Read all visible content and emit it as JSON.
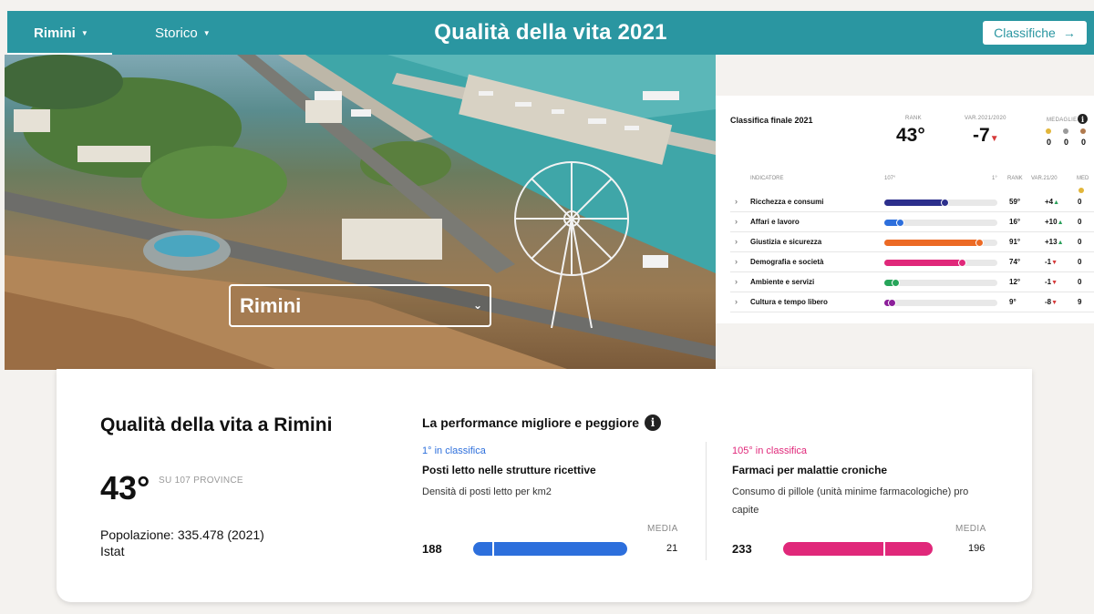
{
  "nav": {
    "city_label": "Rimini",
    "storico_label": "Storico",
    "title": "Qualità della vita 2021",
    "classifiche_label": "Classifiche",
    "classifiche_arrow": "→"
  },
  "hero": {
    "selected_city": "Rimini",
    "chevron": "⌄"
  },
  "ranking": {
    "title": "Classifica finale 2021",
    "rank_label": "RANK",
    "rank_value": "43°",
    "var_label": "VAR.2021/2020",
    "var_value": "-7",
    "var_direction": "down",
    "medals_label": "MEDAGLIE",
    "medals": [
      {
        "color": "#e2b63a",
        "count": "0"
      },
      {
        "color": "#9a9a9a",
        "count": "0"
      },
      {
        "color": "#b07a4e",
        "count": "0"
      }
    ],
    "headers": {
      "indicatore": "INDICATORE",
      "low": "107°",
      "high": "1°",
      "rank": "RANK",
      "var": "VAR.21/20",
      "med": "MED"
    },
    "rows": [
      {
        "name": "Ricchezza e consumi",
        "rank": "59°",
        "var": "+4",
        "dir": "up",
        "medals": "0",
        "color": "#2c2f8c",
        "level": 0.46
      },
      {
        "name": "Affari e lavoro",
        "rank": "16°",
        "var": "+10",
        "dir": "up",
        "medals": "0",
        "color": "#2d6fdc",
        "level": 0.86
      },
      {
        "name": "Giustizia e sicurezza",
        "rank": "91°",
        "var": "+13",
        "dir": "up",
        "medals": "0",
        "color": "#ec6a25",
        "level": 0.16
      },
      {
        "name": "Demografia e società",
        "rank": "74°",
        "var": "-1",
        "dir": "down",
        "medals": "0",
        "color": "#e0287a",
        "level": 0.31
      },
      {
        "name": "Ambiente e servizi",
        "rank": "12°",
        "var": "-1",
        "dir": "down",
        "medals": "0",
        "color": "#27a55a",
        "level": 0.9
      },
      {
        "name": "Cultura e tempo libero",
        "rank": "9°",
        "var": "-8",
        "dir": "down",
        "medals": "9",
        "color": "#8c1f9a",
        "level": 0.93
      }
    ]
  },
  "summary": {
    "title": "Qualità della vita a Rimini",
    "rank": "43°",
    "su": "SU 107 PROVINCE",
    "population": "Popolazione: 335.478 (2021) Istat"
  },
  "performance": {
    "title": "La performance migliore e peggiore",
    "best": {
      "position": "1° in classifica",
      "position_color": "#2d6fdc",
      "indicator": "Posti letto nelle strutture ricettive",
      "description": "Densità di posti letto per km2",
      "media_label": "MEDIA",
      "value": "188",
      "media_value": "21",
      "bar_color": "#2d6fdc",
      "value_number": 188,
      "media_number": 21
    },
    "worst": {
      "position": "105° in classifica",
      "position_color": "#e0287a",
      "indicator": "Farmaci per malattie croniche",
      "description": "Consumo di pillole (unità minime farmacologiche) pro capite",
      "media_label": "MEDIA",
      "value": "233",
      "media_value": "196",
      "bar_color": "#e0287a",
      "value_number": 233,
      "media_number": 196
    }
  }
}
